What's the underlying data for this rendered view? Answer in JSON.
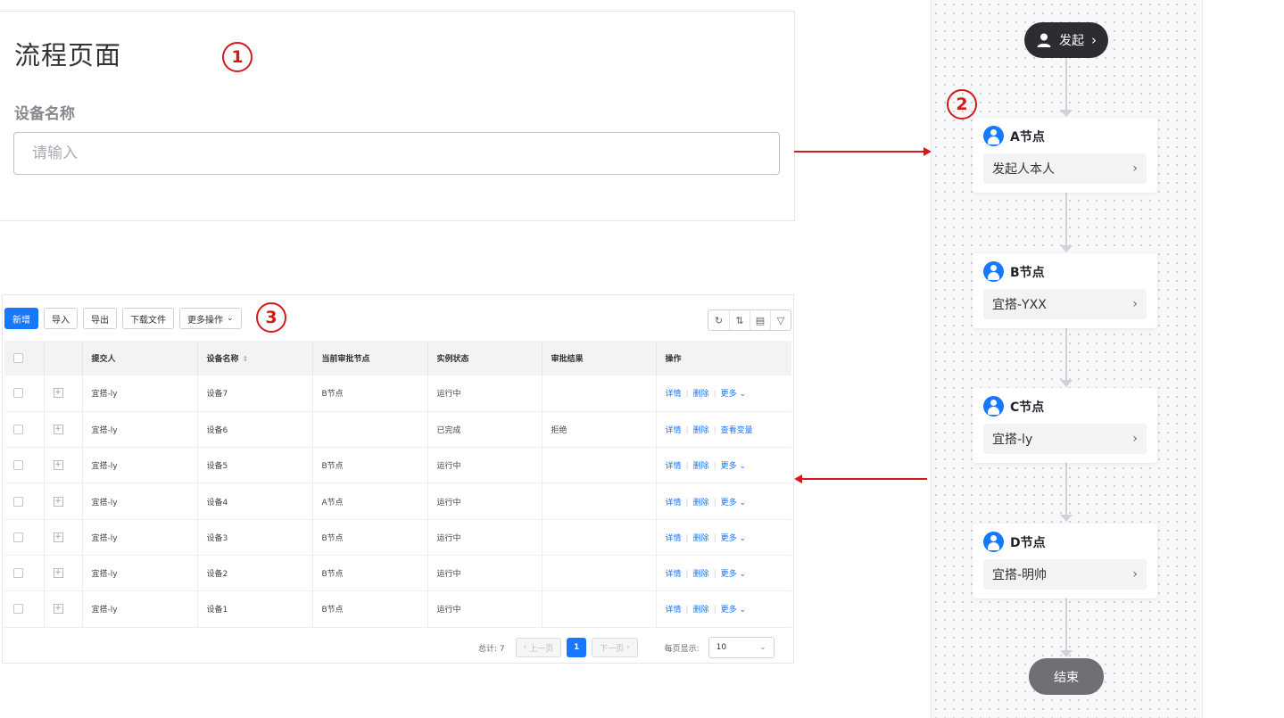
{
  "markers": [
    "1",
    "2",
    "3"
  ],
  "form": {
    "title": "流程页面",
    "label": "设备名称",
    "placeholder": "请输入"
  },
  "toolbar": {
    "add": "新增",
    "import": "导入",
    "export": "导出",
    "download": "下载文件",
    "more_actions": "更多操作"
  },
  "table": {
    "headers": [
      "提交人",
      "设备名称",
      "当前审批节点",
      "实例状态",
      "审批结果",
      "操作"
    ],
    "rows": [
      {
        "submitter": "宜搭-ly",
        "device": "设备7",
        "node": "B节点",
        "status": "运行中",
        "result": "",
        "actions": [
          "详情",
          "删除",
          "更多"
        ]
      },
      {
        "submitter": "宜搭-ly",
        "device": "设备6",
        "node": "",
        "status": "已完成",
        "result": "拒绝",
        "actions": [
          "详情",
          "删除",
          "查看变量"
        ]
      },
      {
        "submitter": "宜搭-ly",
        "device": "设备5",
        "node": "B节点",
        "status": "运行中",
        "result": "",
        "actions": [
          "详情",
          "删除",
          "更多"
        ]
      },
      {
        "submitter": "宜搭-ly",
        "device": "设备4",
        "node": "A节点",
        "status": "运行中",
        "result": "",
        "actions": [
          "详情",
          "删除",
          "更多"
        ]
      },
      {
        "submitter": "宜搭-ly",
        "device": "设备3",
        "node": "B节点",
        "status": "运行中",
        "result": "",
        "actions": [
          "详情",
          "删除",
          "更多"
        ]
      },
      {
        "submitter": "宜搭-ly",
        "device": "设备2",
        "node": "B节点",
        "status": "运行中",
        "result": "",
        "actions": [
          "详情",
          "删除",
          "更多"
        ]
      },
      {
        "submitter": "宜搭-ly",
        "device": "设备1",
        "node": "B节点",
        "status": "运行中",
        "result": "",
        "actions": [
          "详情",
          "删除",
          "更多"
        ]
      }
    ]
  },
  "pagination": {
    "total": "总计: 7",
    "prev": "上一页",
    "current": "1",
    "next": "下一页",
    "page_size_label": "每页显示:",
    "page_size": "10"
  },
  "flow": {
    "start": "发起",
    "end": "结束",
    "nodes": [
      {
        "title": "A节点",
        "assignee": "发起人本人"
      },
      {
        "title": "B节点",
        "assignee": "宜搭-YXX"
      },
      {
        "title": "C节点",
        "assignee": "宜搭-ly"
      },
      {
        "title": "D节点",
        "assignee": "宜搭-明帅"
      }
    ]
  },
  "colors": {
    "annotation": "#d71818",
    "primary": "#1677ff"
  }
}
